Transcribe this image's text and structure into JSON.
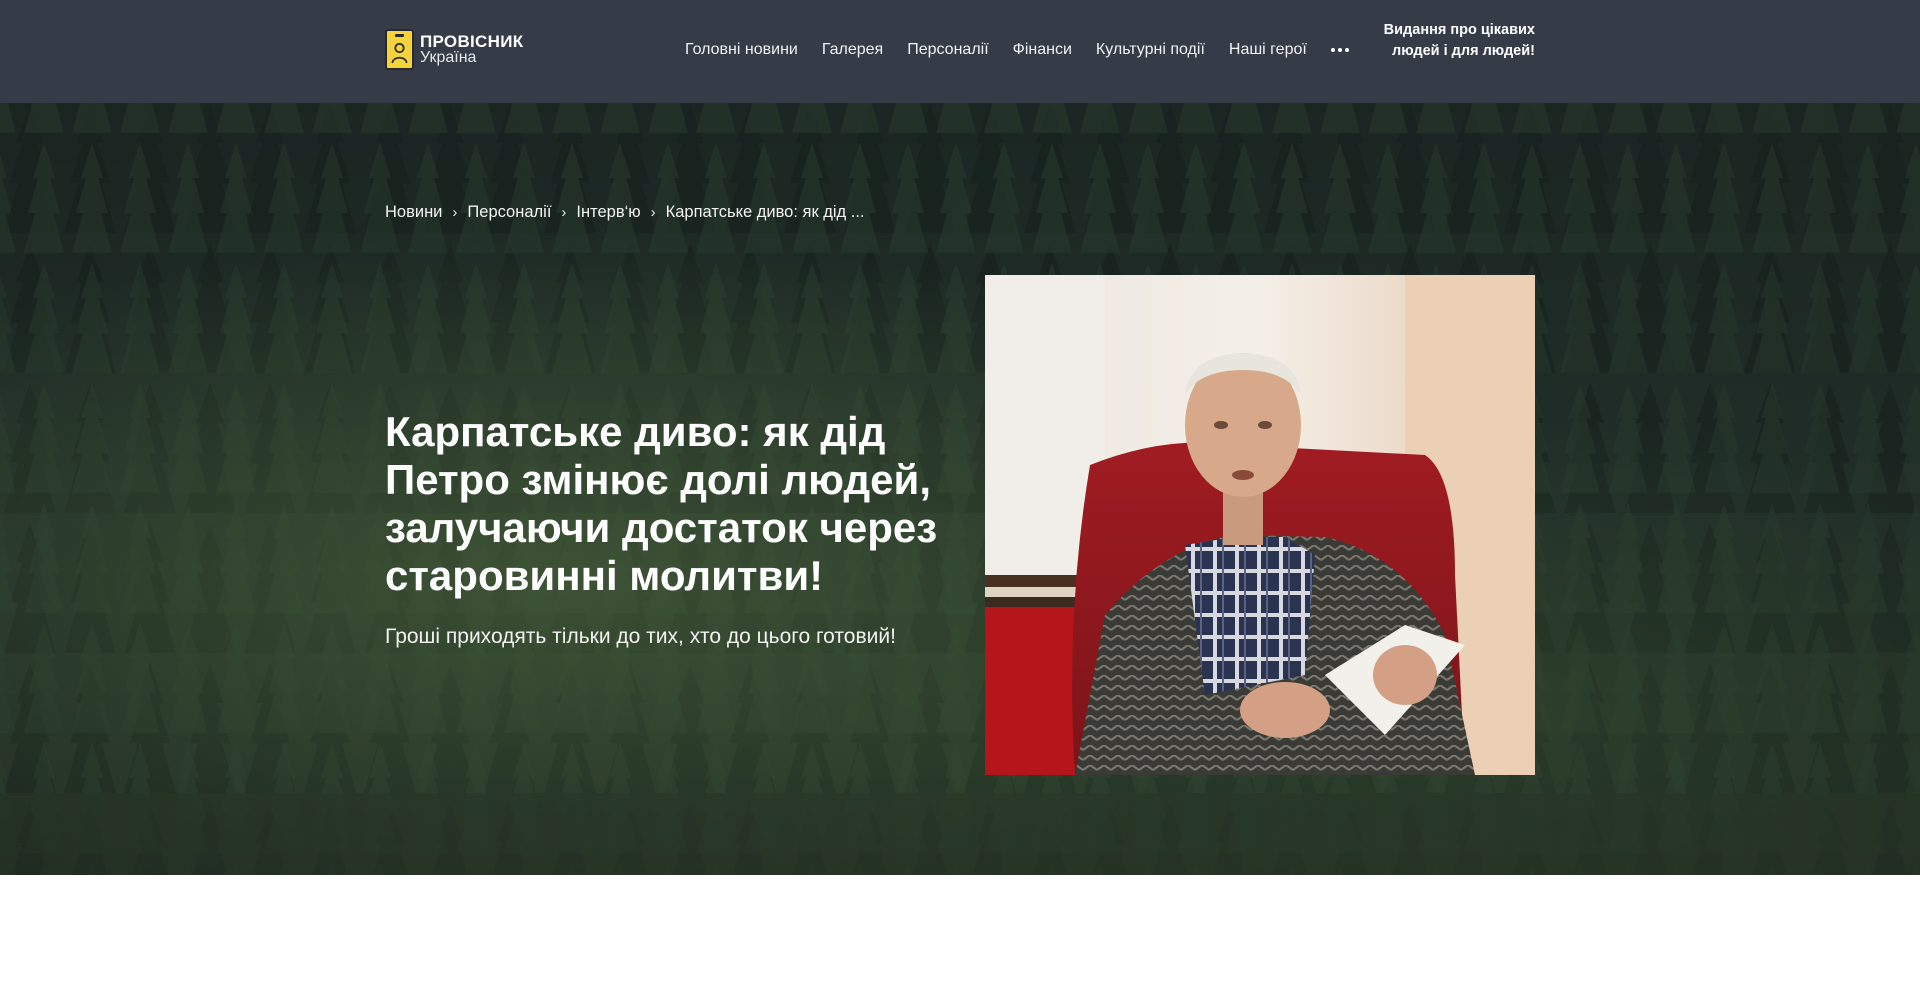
{
  "header": {
    "logo": {
      "title": "ПРОВІСНИК",
      "subtitle": "Україна",
      "icon": "id-badge-icon"
    },
    "nav": [
      {
        "label": "Головні новини"
      },
      {
        "label": "Галерея"
      },
      {
        "label": "Персоналії"
      },
      {
        "label": "Фінанси"
      },
      {
        "label": "Культурні події"
      },
      {
        "label": "Наші герої"
      }
    ],
    "more_icon": "more-horizontal-icon",
    "tagline": "Видання про цікавих людей і для людей!"
  },
  "breadcrumb": [
    {
      "label": "Новини"
    },
    {
      "label": "Персоналії"
    },
    {
      "label": "Інтерв‘ю"
    },
    {
      "label": "Карпатське диво: як дід ..."
    }
  ],
  "article": {
    "title": "Карпатське диво: як дід Петро змінює долі людей, залучаючи достаток через старовинні молитви!",
    "subtitle": "Гроші приходять тільки до тих, хто до цього готовий!"
  },
  "colors": {
    "header_bg": "#353b47",
    "logo_yellow": "#f4d33b",
    "text": "#ffffff",
    "forest_dark": "#1f2b27"
  }
}
